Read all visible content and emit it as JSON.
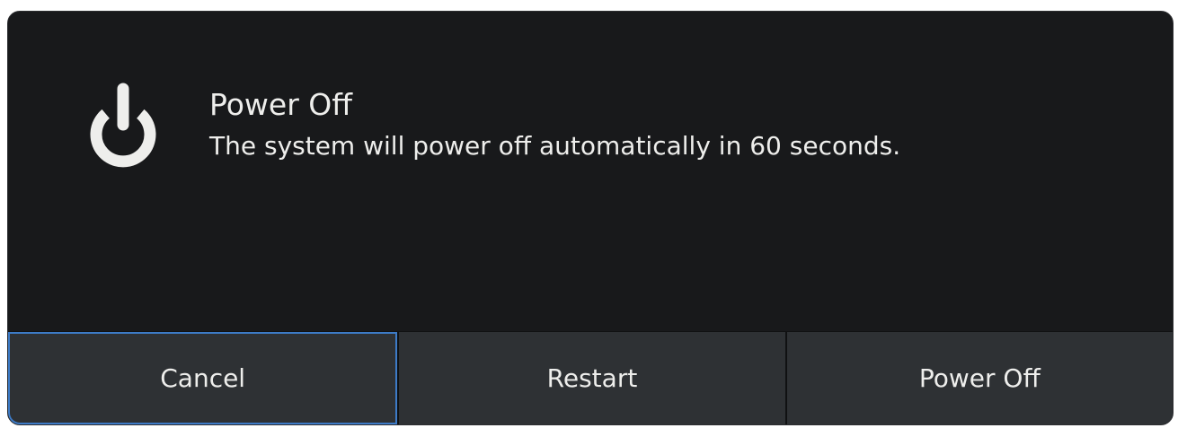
{
  "dialog": {
    "title": "Power Off",
    "message": "The system will power off automatically in 60 seconds.",
    "icon": "power-icon",
    "buttons": {
      "cancel": "Cancel",
      "restart": "Restart",
      "power_off": "Power Off"
    },
    "focused_button": "cancel"
  },
  "colors": {
    "dialog_background": "#18191b",
    "button_background": "#2e3134",
    "text": "#eeeeec",
    "focus_ring": "#3d7bc7"
  }
}
